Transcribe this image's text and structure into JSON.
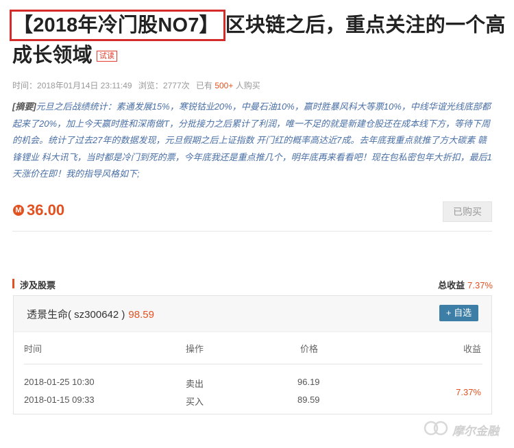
{
  "article": {
    "title_highlight": "【2018年冷门股NO7】",
    "title_rest": "区块链之后，重点关注的一个高成长领域",
    "trial_tag": "试读"
  },
  "meta": {
    "time_label": "时间：",
    "time_value": "2018年01月14日 23:11:49",
    "views_label": "浏览：",
    "views_value": "2777次",
    "buyers_prefix": "已有",
    "buyers_count": "500+",
    "buyers_suffix": "人购买"
  },
  "summary": {
    "tag": "[摘要]",
    "text": "元旦之后战绩统计：素通发展15%，寒锐钴业20%，中曼石油10%，赢时胜暴风科大等票10%，中线华谊光线底部都起来了20%，加上今天赢时胜和深南做T，分批接力之后累计了利润，唯一不足的就是新建仓股还在成本线下方，等待下周的机会。统计了过去27年的数据发现，元旦假期之后上证指数 开门红的概率高达近7成。去年底我重点就推了方大碳素 赣锋锂业 科大讯飞，当时都是冷门到死的票，今年底我还是重点推几个，明年底再来看看吧！现在包私密包年大折扣，最后1天涨价在即！我的指导风格如下;"
  },
  "purchase": {
    "coin_symbol": "M",
    "price": "36.00",
    "bought_label": "已购买"
  },
  "stocks_section": {
    "title": "涉及股票",
    "total_label": "总收益",
    "total_value": "7.37%"
  },
  "stock": {
    "name": "透景生命( sz300642 )",
    "price": "98.59",
    "add_label": "+ 自选"
  },
  "trade_table": {
    "headers": {
      "time": "时间",
      "action": "操作",
      "price": "价格",
      "return": "收益"
    },
    "rows": [
      {
        "time": "2018-01-25 10:30",
        "action": "卖出",
        "price": "96.19"
      },
      {
        "time": "2018-01-15 09:33",
        "action": "买入",
        "price": "89.59"
      }
    ],
    "return_value": "7.37%"
  },
  "watermark": {
    "text": "摩尔金融"
  },
  "colors": {
    "accent": "#e2511f",
    "highlight_border": "#d42a2a",
    "button_blue": "#3d7ea6",
    "summary_text": "#4a6fa5"
  }
}
